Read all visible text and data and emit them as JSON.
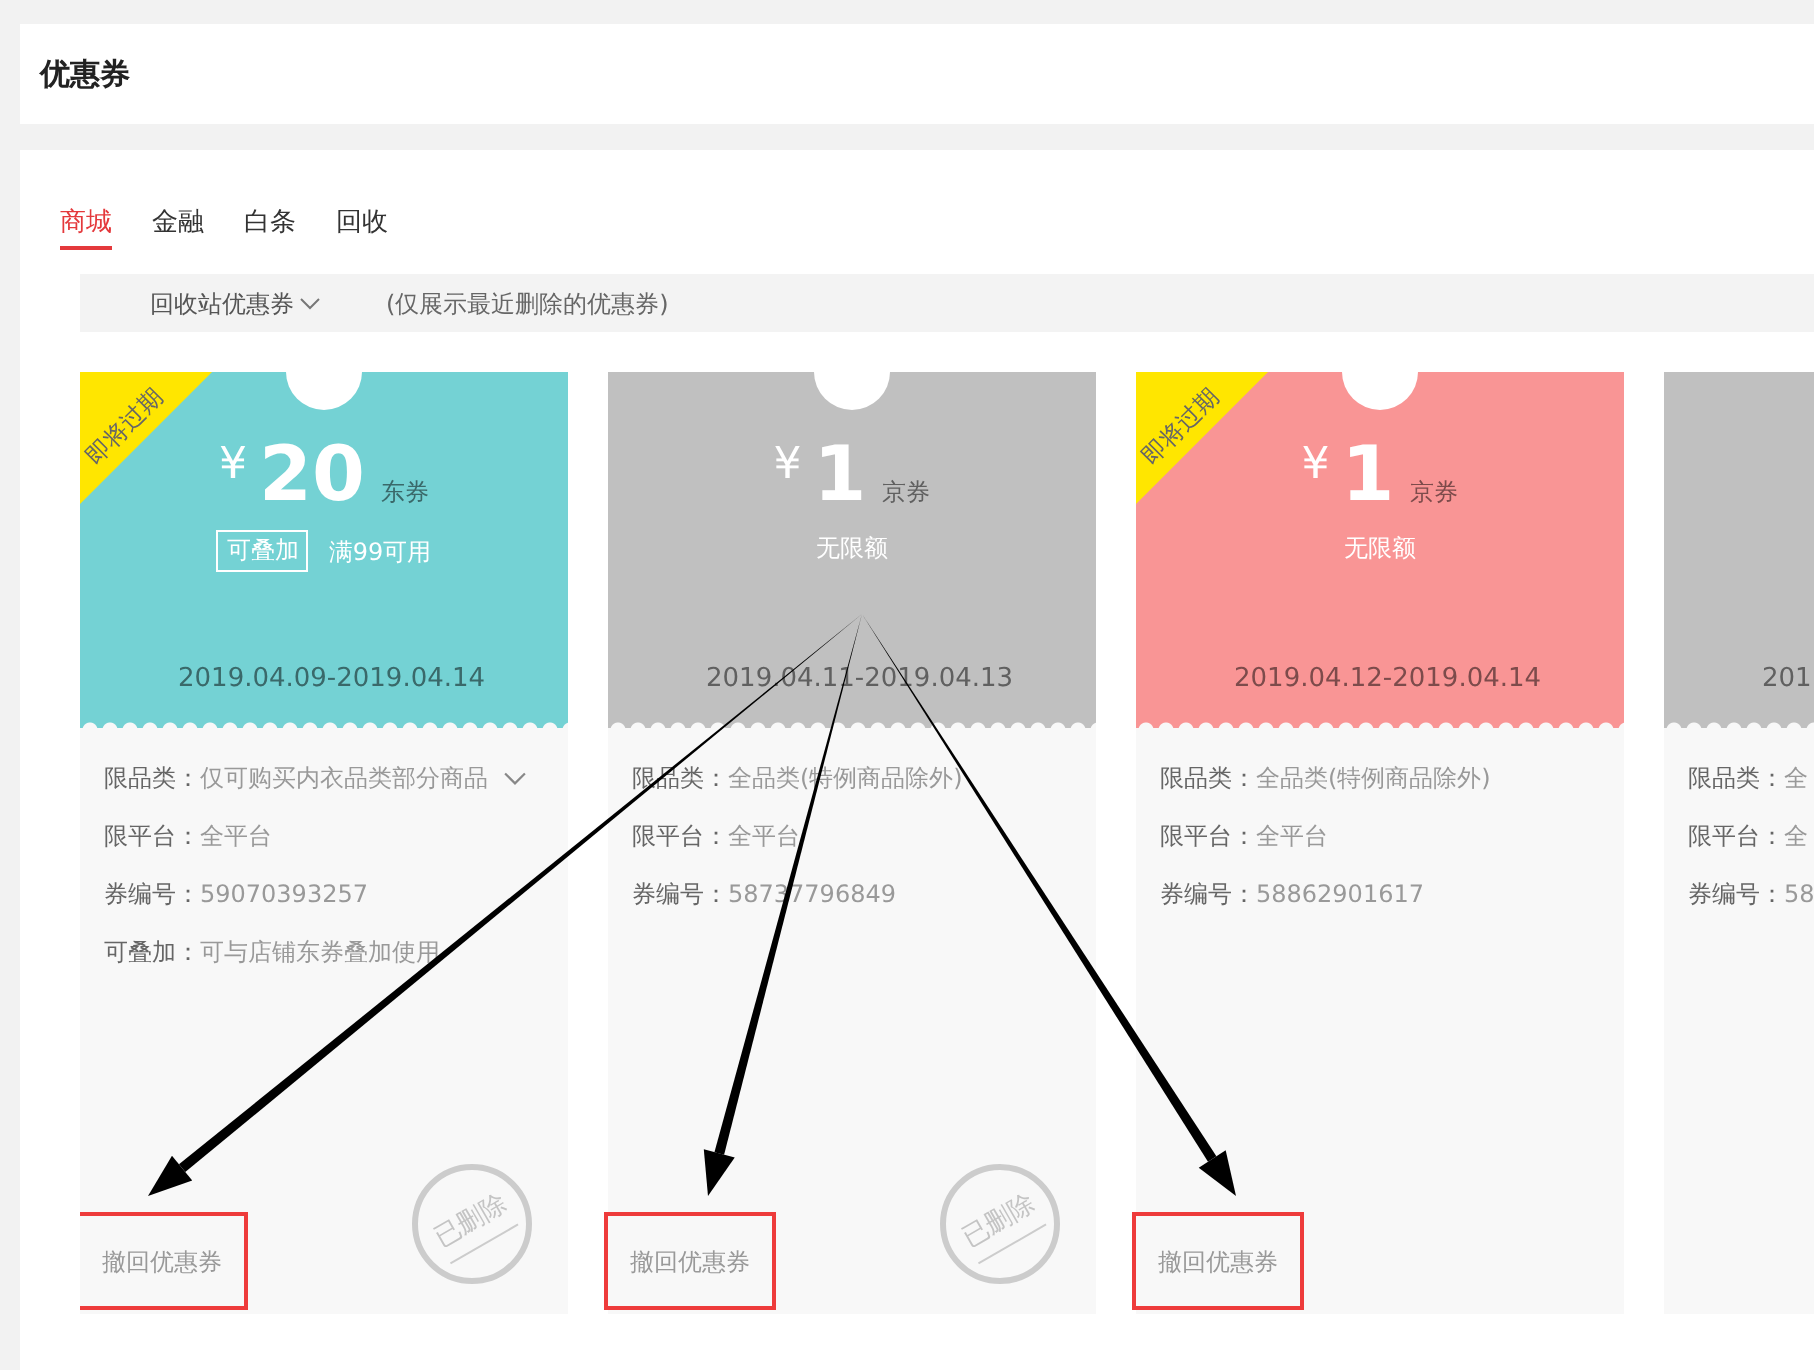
{
  "page_title": "优惠券",
  "tabs": [
    {
      "label": "商城",
      "selected": true
    },
    {
      "label": "金融",
      "selected": false
    },
    {
      "label": "白条",
      "selected": false
    },
    {
      "label": "回收",
      "selected": false
    }
  ],
  "filter": {
    "dropdown": "回收站优惠券",
    "note": "(仅展示最近删除的优惠券)"
  },
  "coupons": [
    {
      "color": "#74d2d4",
      "expiring_badge": "即将过期",
      "currency": "¥",
      "amount": "20",
      "unit": "东券",
      "tag": "可叠加",
      "condition": "满99可用",
      "date_range": "2019.04.09-2019.04.14",
      "details": [
        {
          "label": "限品类：",
          "value": "仅可购买内衣品类部分商品",
          "expandable": true
        },
        {
          "label": "限平台：",
          "value": "全平台"
        },
        {
          "label": "券编号：",
          "value": "59070393257"
        },
        {
          "label": "可叠加：",
          "value": "可与店铺东券叠加使用"
        }
      ],
      "deleted_stamp": "已删除",
      "restore_button": {
        "label": "撤回优惠券",
        "highlighted": true
      }
    },
    {
      "color": "#c0c0c0",
      "currency": "¥",
      "amount": "1",
      "unit": "京券",
      "condition": "无限额",
      "date_range": "2019.04.11-2019.04.13",
      "details": [
        {
          "label": "限品类：",
          "value": "全品类(特例商品除外)"
        },
        {
          "label": "限平台：",
          "value": "全平台"
        },
        {
          "label": "券编号：",
          "value": "58737796849"
        }
      ],
      "deleted_stamp": "已删除",
      "restore_button": {
        "label": "撤回优惠券",
        "highlighted": true
      }
    },
    {
      "color": "#f99595",
      "expiring_badge": "即将过期",
      "currency": "¥",
      "amount": "1",
      "unit": "京券",
      "condition": "无限额",
      "date_range": "2019.04.12-2019.04.14",
      "details": [
        {
          "label": "限品类：",
          "value": "全品类(特例商品除外)"
        },
        {
          "label": "限平台：",
          "value": "全平台"
        },
        {
          "label": "券编号：",
          "value": "58862901617"
        }
      ],
      "restore_button": {
        "label": "撤回优惠券",
        "highlighted": true
      }
    },
    {
      "color": "#c0c0c0",
      "date_range": "201",
      "details": [
        {
          "label": "限品类：",
          "value": "全"
        },
        {
          "label": "限平台：",
          "value": "全"
        },
        {
          "label": "券编号：",
          "value": "58"
        }
      ]
    }
  ]
}
